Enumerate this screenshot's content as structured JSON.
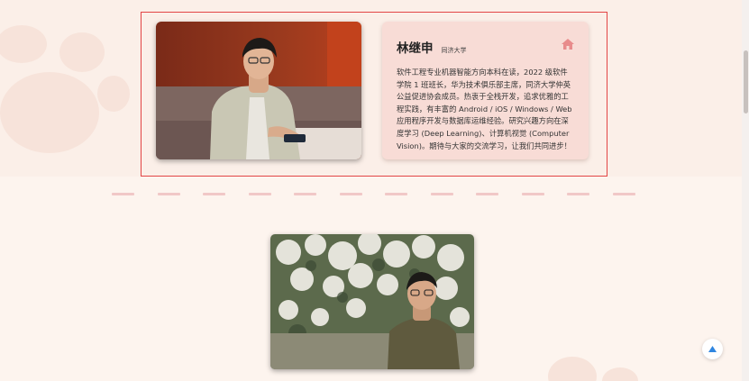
{
  "profile": {
    "name": "林继申",
    "school": "同济大学",
    "bio": "软件工程专业机器智能方向本科在读，2022 级软件学院 1 班班长，华为技术俱乐部主席，同济大学仲英公益促进协会成员。热衷于全栈开发，追求优雅的工程实践，有丰富的 Android / iOS / Windows / Web 应用程序开发与数据库运维经验。研究兴趣方向在深度学习 (Deep Learning)、计算机视觉 (Computer Vision)。期待与大家的交流学习，让我们共同进步！",
    "photo_icon": "portrait-photo",
    "home_icon": "home-icon",
    "accent": "#e88c8c",
    "frame_color": "#e24545"
  },
  "gallery": {
    "photo_icon": "blossom-portrait-photo"
  },
  "controls": {
    "to_top_icon": "arrow-up-icon",
    "accent": "#2f86e0"
  }
}
